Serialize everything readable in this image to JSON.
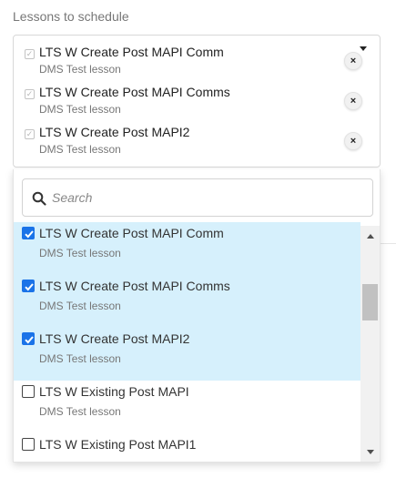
{
  "field": {
    "label": "Lessons to schedule"
  },
  "selected": [
    {
      "title": "LTS W Create Post MAPI Comm",
      "subtitle": "DMS Test lesson",
      "remove": "×"
    },
    {
      "title": "LTS W Create Post MAPI Comms",
      "subtitle": "DMS Test lesson",
      "remove": "×"
    },
    {
      "title": "LTS W Create Post MAPI2",
      "subtitle": "DMS Test lesson",
      "remove": "×"
    }
  ],
  "search": {
    "placeholder": "Search",
    "value": ""
  },
  "options": [
    {
      "title": "LTS W Create Post MAPI Comm",
      "subtitle": "DMS Test lesson",
      "checked": true
    },
    {
      "title": "LTS W Create Post MAPI Comms",
      "subtitle": "DMS Test lesson",
      "checked": true
    },
    {
      "title": "LTS W Create Post MAPI2",
      "subtitle": "DMS Test lesson",
      "checked": true
    },
    {
      "title": "LTS W Existing Post MAPI",
      "subtitle": "DMS Test lesson",
      "checked": false
    },
    {
      "title": "LTS W Existing Post MAPI1",
      "subtitle": "",
      "checked": false
    }
  ],
  "icons": {
    "chip_check": "check-icon",
    "remove": "close-icon",
    "caret": "caret-down-icon",
    "search": "search-icon"
  },
  "colors": {
    "selected_row": "#d6f0fc",
    "checkbox_checked": "#1a73e8"
  }
}
